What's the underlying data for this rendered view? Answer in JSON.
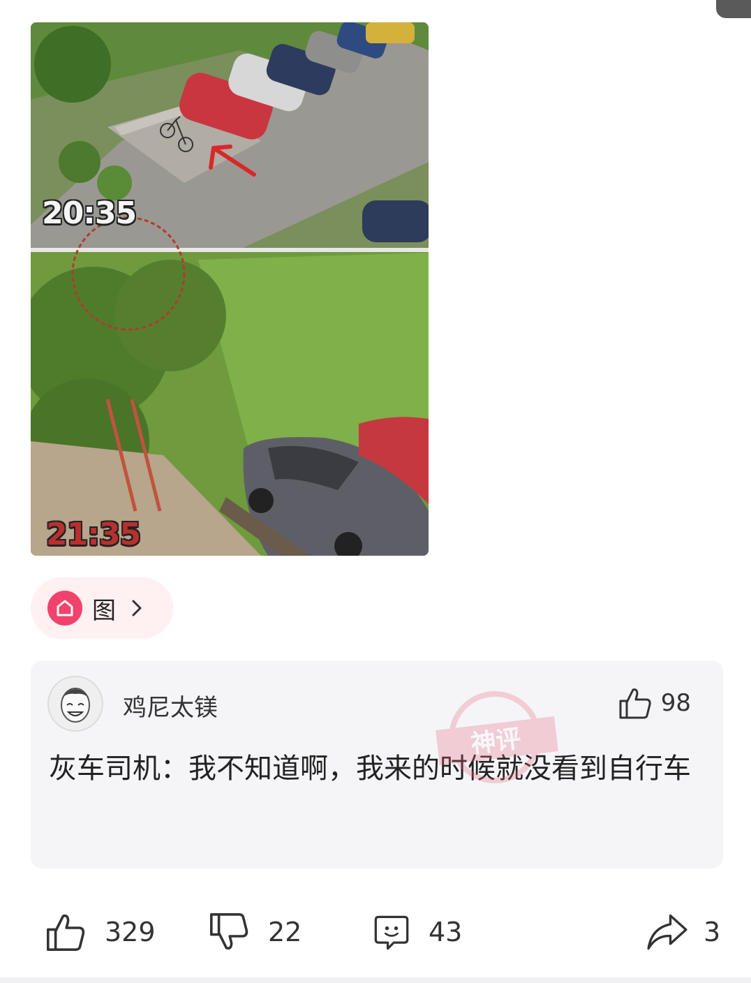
{
  "post": {
    "image": {
      "stamps": {
        "top": "20:35",
        "bottom": "21:35"
      }
    },
    "tag": {
      "icon": "home-icon",
      "label": "图",
      "chevron": "chevron-right-icon"
    }
  },
  "comment": {
    "username": "鸡尼太镁",
    "likes": "98",
    "text": "灰车司机：我不知道啊，我来的时候就没看到自行车",
    "watermark": "神评",
    "colors": {
      "watermark": "#e8647a"
    }
  },
  "actions": {
    "like": {
      "icon": "thumbs-up-icon",
      "count": "329"
    },
    "dislike": {
      "icon": "thumbs-down-icon",
      "count": "22"
    },
    "comment": {
      "icon": "comment-icon",
      "count": "43"
    },
    "share": {
      "icon": "share-icon",
      "count": "3"
    }
  },
  "colors": {
    "accent": "#f0426b",
    "tag_background": "#fff0f2",
    "card_background": "#f5f5f8"
  }
}
